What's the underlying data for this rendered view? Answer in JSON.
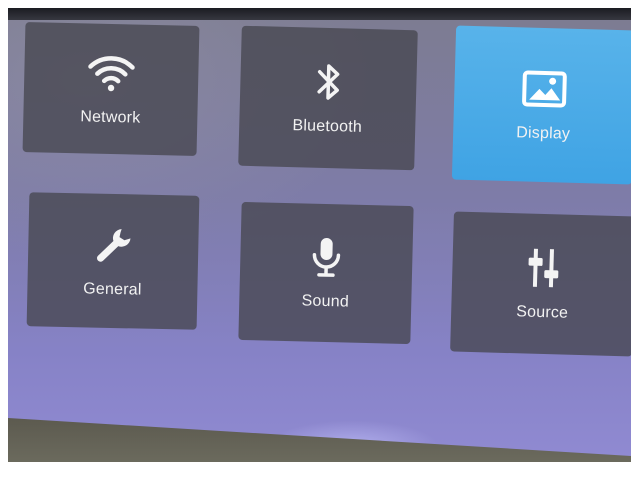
{
  "settings_menu": {
    "tiles": [
      {
        "id": "network",
        "label": "Network",
        "icon": "wifi-icon",
        "selected": false
      },
      {
        "id": "bluetooth",
        "label": "Bluetooth",
        "icon": "bluetooth-icon",
        "selected": false
      },
      {
        "id": "display",
        "label": "Display",
        "icon": "image-icon",
        "selected": true
      },
      {
        "id": "general",
        "label": "General",
        "icon": "wrench-icon",
        "selected": false
      },
      {
        "id": "sound",
        "label": "Sound",
        "icon": "microphone-icon",
        "selected": false
      },
      {
        "id": "source",
        "label": "Source",
        "icon": "sliders-icon",
        "selected": false
      }
    ]
  },
  "colors": {
    "selected_tile": "#4aa9e7",
    "tile": "#46464f",
    "background": "#8682c6"
  }
}
